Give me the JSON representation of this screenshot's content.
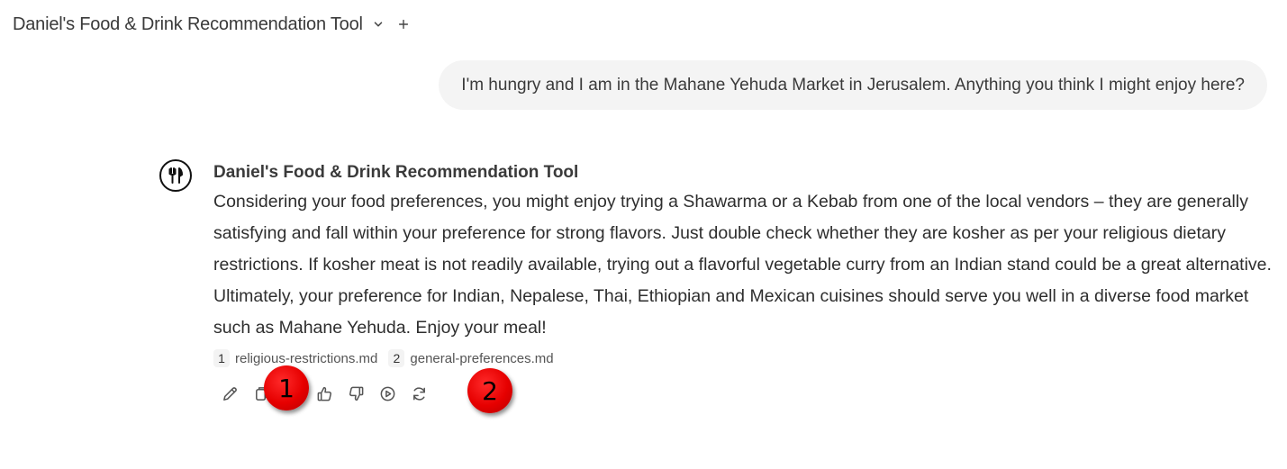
{
  "header": {
    "title": "Daniel's Food & Drink Recommendation Tool",
    "dropdown_icon": "chevron-down-icon",
    "new_icon": "plus-icon"
  },
  "user_message": {
    "text": "I'm hungry and I am in the Mahane Yehuda Market in Jerusalem. Anything you think I might enjoy here?"
  },
  "assistant_message": {
    "avatar_icon": "fork-knife-icon",
    "name": "Daniel's Food & Drink Recommendation Tool",
    "text": "Considering your food preferences, you might enjoy trying a Shawarma or a Kebab from one of the local vendors – they are generally satisfying and fall within your preference for strong flavors. Just double check whether they are kosher as per your religious dietary restrictions. If kosher meat is not readily available, trying out a flavorful vegetable curry from an Indian stand could be a great alternative. Ultimately, your preference for Indian, Nepalese, Thai, Ethiopian and Mexican cuisines should serve you well in a diverse food market such as Mahane Yehuda. Enjoy your meal!",
    "citations": [
      {
        "num": "1",
        "file": "religious-restrictions.md"
      },
      {
        "num": "2",
        "file": "general-preferences.md"
      }
    ],
    "actions": [
      "edit-icon",
      "copy-icon",
      "image-icon",
      "thumbs-up-icon",
      "thumbs-down-icon",
      "play-icon",
      "regenerate-icon"
    ]
  },
  "markers": [
    {
      "label": "1",
      "color": "#e60000"
    },
    {
      "label": "2",
      "color": "#e60000"
    }
  ]
}
